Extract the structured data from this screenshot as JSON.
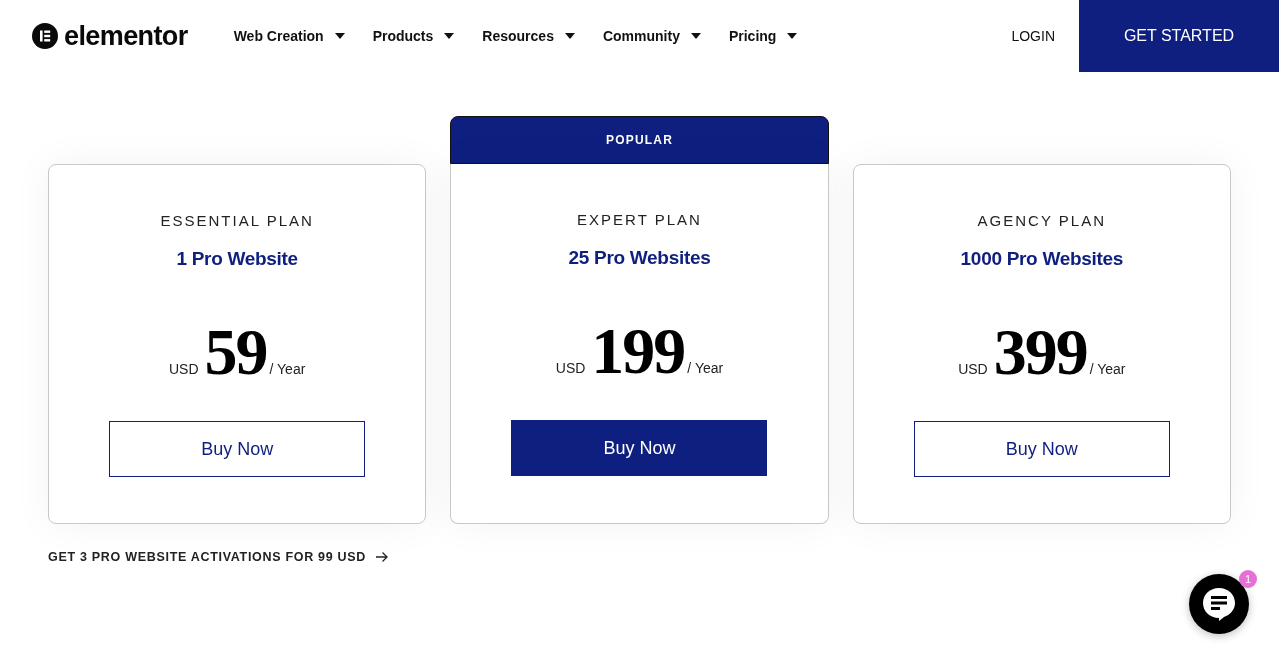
{
  "header": {
    "logo": "elementor",
    "nav": [
      "Web Creation",
      "Products",
      "Resources",
      "Community",
      "Pricing"
    ],
    "login": "LOGIN",
    "cta": "GET STARTED"
  },
  "plans": [
    {
      "name": "ESSENTIAL PLAN",
      "websites": "1 Pro Website",
      "currency": "USD",
      "price": "59",
      "period": "/ Year",
      "button": "Buy Now",
      "popular": false
    },
    {
      "badge": "POPULAR",
      "name": "EXPERT PLAN",
      "websites": "25 Pro Websites",
      "currency": "USD",
      "price": "199",
      "period": "/ Year",
      "button": "Buy Now",
      "popular": true
    },
    {
      "name": "AGENCY PLAN",
      "websites": "1000 Pro Websites",
      "currency": "USD",
      "price": "399",
      "period": "/ Year",
      "button": "Buy Now",
      "popular": false
    }
  ],
  "promo_link": "GET 3 PRO WEBSITE ACTIVATIONS FOR 99 USD",
  "chat": {
    "badge": "1"
  }
}
